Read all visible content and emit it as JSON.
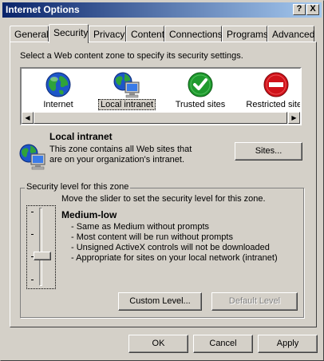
{
  "window": {
    "title": "Internet Options",
    "help_label": "?",
    "close_label": "X"
  },
  "tabs": [
    {
      "label": "General"
    },
    {
      "label": "Security",
      "active": true
    },
    {
      "label": "Privacy"
    },
    {
      "label": "Content"
    },
    {
      "label": "Connections"
    },
    {
      "label": "Programs"
    },
    {
      "label": "Advanced"
    }
  ],
  "security": {
    "instruction": "Select a Web content zone to specify its security settings.",
    "zones": [
      {
        "label": "Internet",
        "icon": "globe-icon"
      },
      {
        "label": "Local intranet",
        "icon": "local-intranet-icon",
        "selected": true
      },
      {
        "label": "Trusted sites",
        "icon": "trusted-sites-icon"
      },
      {
        "label": "Restricted sites",
        "icon": "restricted-sites-icon"
      }
    ],
    "selected_zone": {
      "name": "Local intranet",
      "description_line1": "This zone contains all Web sites that",
      "description_line2": "are on your organization's intranet.",
      "sites_button": "Sites..."
    },
    "level_group": {
      "legend": "Security level for this zone",
      "slider_instruction": "Move the slider to set the security level for this zone.",
      "level_name": "Medium-low",
      "bullets": [
        "- Same as Medium without prompts",
        "- Most content will be run without prompts",
        "- Unsigned ActiveX controls will not be downloaded",
        "- Appropriate for sites on your local network (intranet)"
      ],
      "custom_level_button": "Custom Level...",
      "default_level_button": "Default Level"
    }
  },
  "footer": {
    "ok": "OK",
    "cancel": "Cancel",
    "apply": "Apply"
  },
  "colors": {
    "titlebar_start": "#0a246a",
    "titlebar_end": "#a6caf0",
    "face": "#d4d0c8",
    "trusted_green": "#1f9a2e",
    "restricted_red": "#d0121a"
  }
}
